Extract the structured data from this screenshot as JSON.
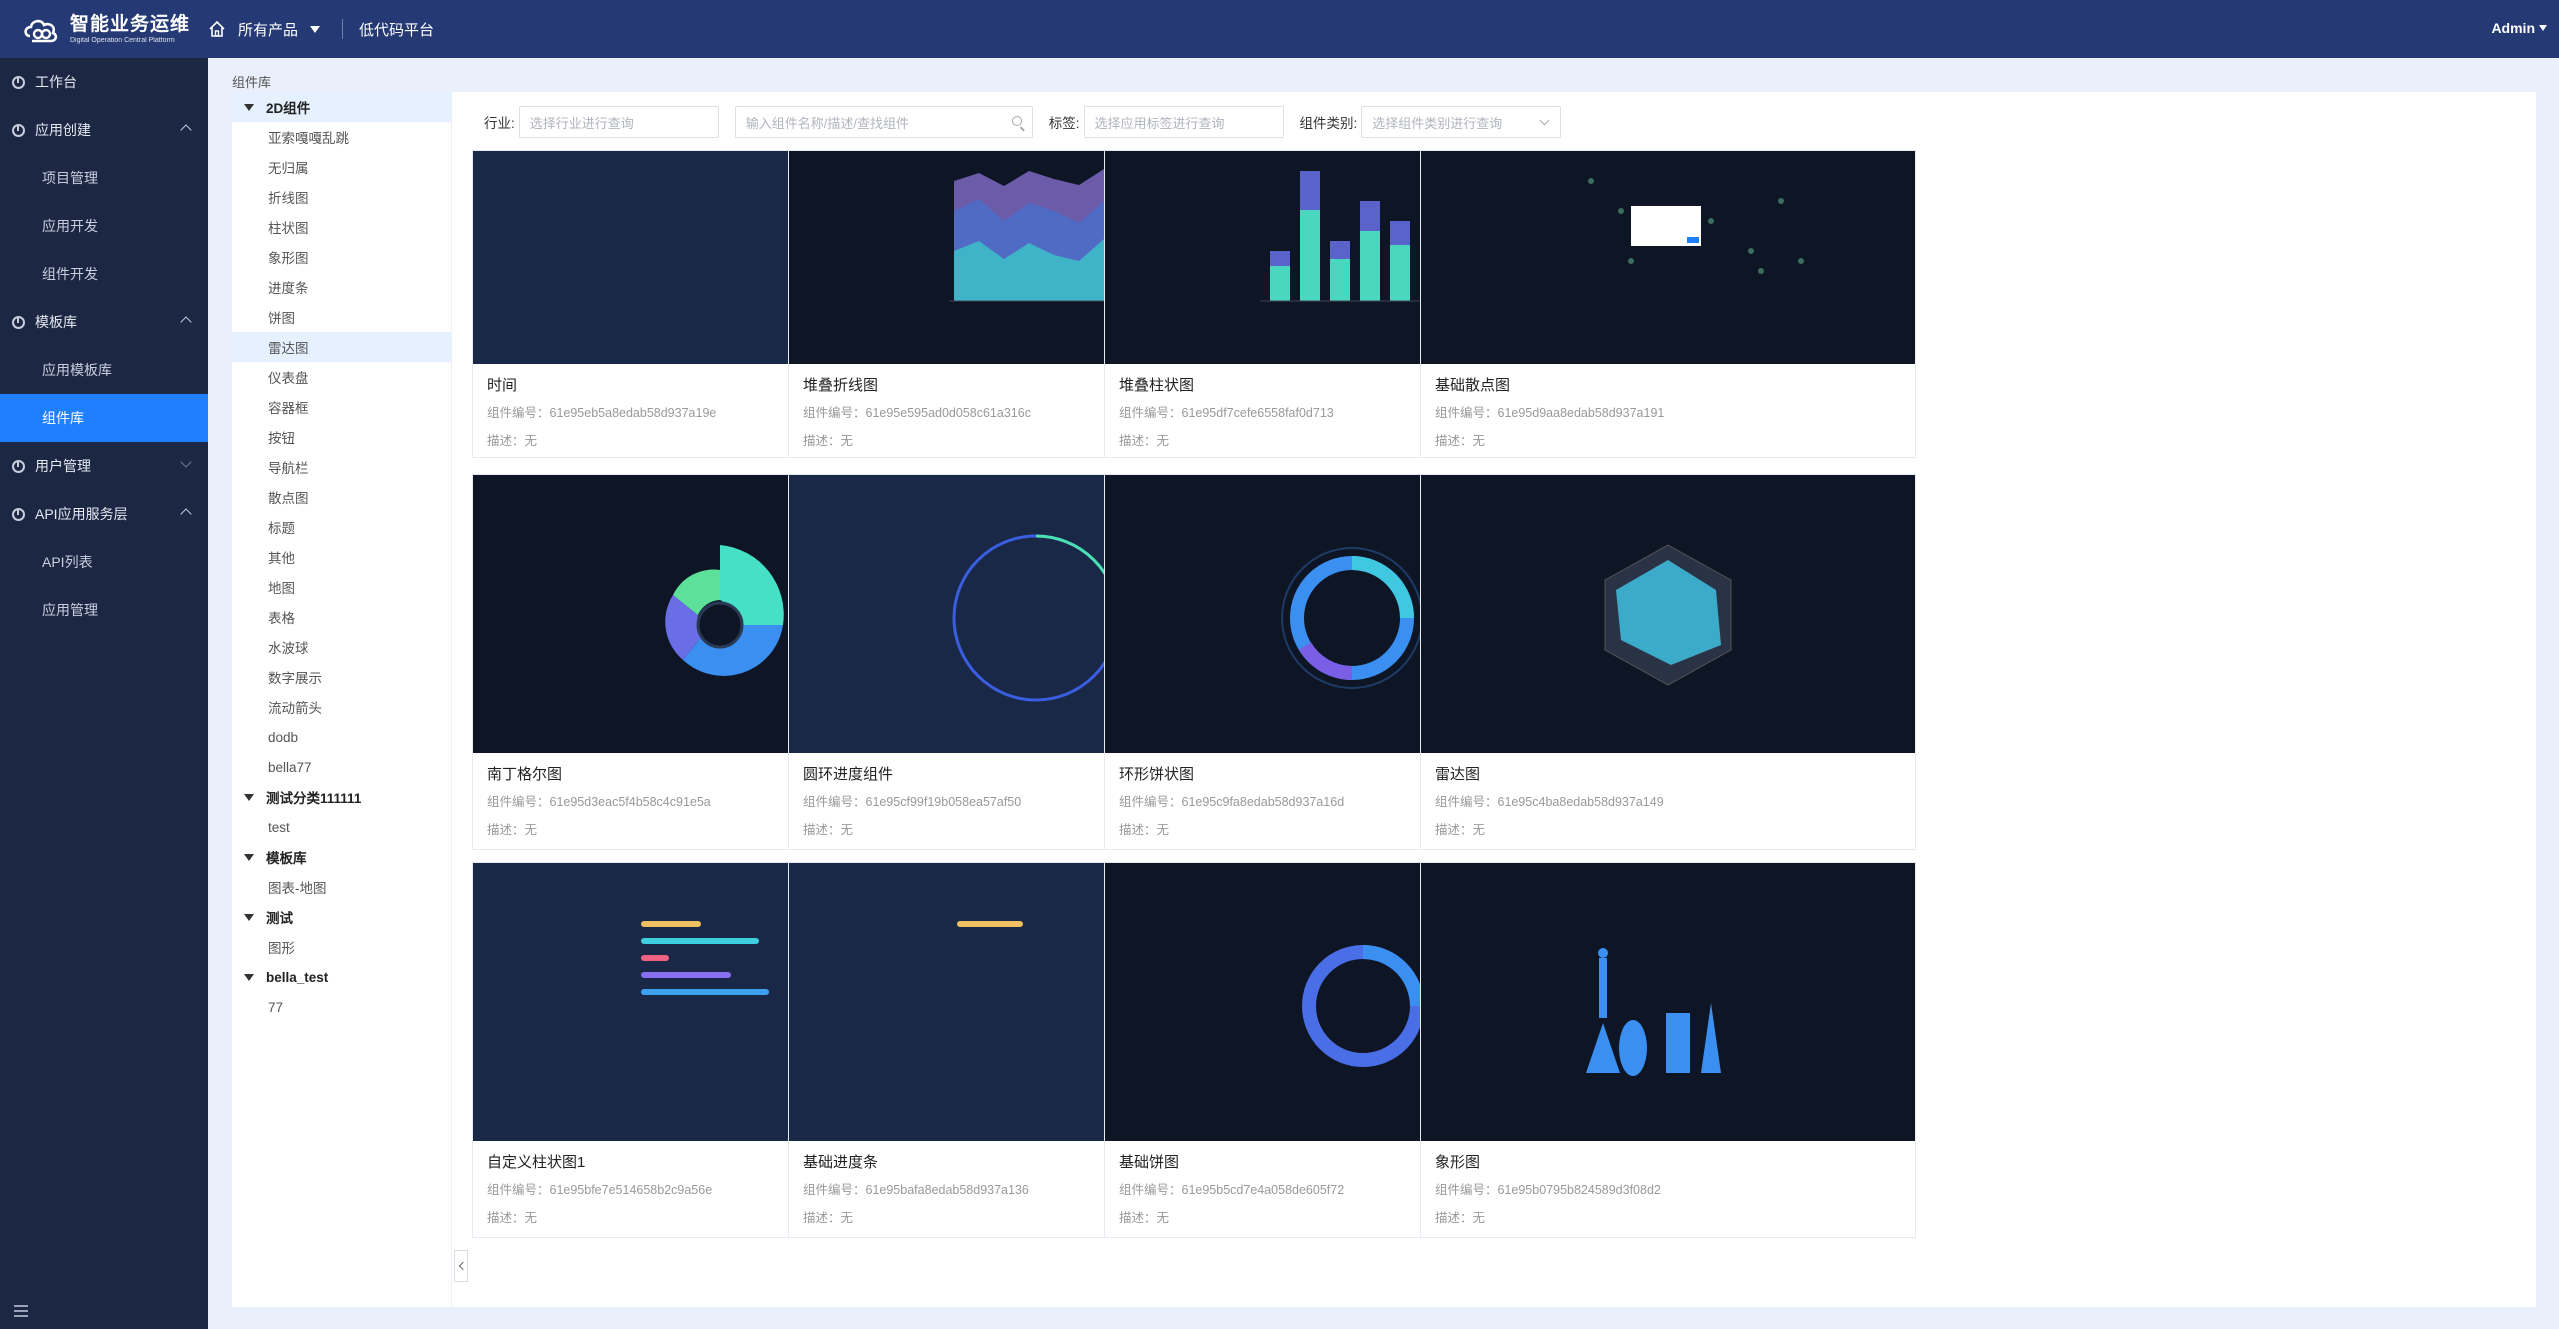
{
  "header": {
    "logo_main": "智能业务运维",
    "logo_sub": "Digital Operation Central Platform",
    "all_products": "所有产品",
    "platform": "低代码平台",
    "user": "Admin"
  },
  "sidebar": {
    "items": [
      {
        "type": "group",
        "label": "工作台"
      },
      {
        "type": "group",
        "label": "应用创建"
      },
      {
        "type": "item",
        "label": "项目管理"
      },
      {
        "type": "item",
        "label": "应用开发"
      },
      {
        "type": "item",
        "label": "组件开发"
      },
      {
        "type": "group",
        "label": "模板库"
      },
      {
        "type": "item",
        "label": "应用模板库"
      },
      {
        "type": "item",
        "label": "组件库",
        "active": true
      },
      {
        "type": "group",
        "label": "用户管理"
      },
      {
        "type": "group",
        "label": "API应用服务层"
      },
      {
        "type": "item",
        "label": "API列表"
      },
      {
        "type": "item",
        "label": "应用管理"
      }
    ]
  },
  "breadcrumb": "组件库",
  "tree": [
    {
      "label": "2D组件",
      "parent": true
    },
    {
      "label": "亚索嘎嘎乱跳"
    },
    {
      "label": "无归属"
    },
    {
      "label": "折线图"
    },
    {
      "label": "柱状图"
    },
    {
      "label": "象形图"
    },
    {
      "label": "进度条"
    },
    {
      "label": "饼图"
    },
    {
      "label": "雷达图",
      "selected": true
    },
    {
      "label": "仪表盘"
    },
    {
      "label": "容器框"
    },
    {
      "label": "按钮"
    },
    {
      "label": "导航栏"
    },
    {
      "label": "散点图"
    },
    {
      "label": "标题"
    },
    {
      "label": "其他"
    },
    {
      "label": "地图"
    },
    {
      "label": "表格"
    },
    {
      "label": "水波球"
    },
    {
      "label": "数字展示"
    },
    {
      "label": "流动箭头"
    },
    {
      "label": "dodb"
    },
    {
      "label": "bella77"
    },
    {
      "label": "测试分类111111",
      "parent": true
    },
    {
      "label": "test"
    },
    {
      "label": "模板库",
      "parent": true
    },
    {
      "label": "图表-地图"
    },
    {
      "label": "测试",
      "parent": true
    },
    {
      "label": "图形"
    },
    {
      "label": "bella_test",
      "parent": true
    },
    {
      "label": "77"
    }
  ],
  "filters": {
    "industry_label": "行业:",
    "industry_placeholder": "选择行业进行查询",
    "search_placeholder": "输入组件名称/描述/查找组件",
    "tag_label": "标签:",
    "tag_placeholder": "选择应用标签进行查询",
    "category_label": "组件类别:",
    "category_placeholder": "选择组件类别进行查询"
  },
  "cards": [
    {
      "title": "时间",
      "id": "组件编号：61e95eb5a8edab58d937a19e",
      "desc": "描述：无"
    },
    {
      "title": "堆叠折线图",
      "id": "组件编号：61e95e595ad0d058c61a316c",
      "desc": "描述：无"
    },
    {
      "title": "堆叠柱状图",
      "id": "组件编号：61e95df7cefe6558faf0d713",
      "desc": "描述：无"
    },
    {
      "title": "基础散点图",
      "id": "组件编号：61e95d9aa8edab58d937a191",
      "desc": "描述：无"
    },
    {
      "title": "南丁格尔图",
      "id": "组件编号：61e95d3eac5f4b58c4c91e5a",
      "desc": "描述：无"
    },
    {
      "title": "圆环进度组件",
      "id": "组件编号：61e95cf99f19b058ea57af50",
      "desc": "描述：无"
    },
    {
      "title": "环形饼状图",
      "id": "组件编号：61e95c9fa8edab58d937a16d",
      "desc": "描述：无"
    },
    {
      "title": "雷达图",
      "id": "组件编号：61e95c4ba8edab58d937a149",
      "desc": "描述：无"
    },
    {
      "title": "自定义柱状图1",
      "id": "组件编号：61e95bfe7e514658b2c9a56e",
      "desc": "描述：无"
    },
    {
      "title": "基础进度条",
      "id": "组件编号：61e95bafa8edab58d937a136",
      "desc": "描述：无"
    },
    {
      "title": "基础饼图",
      "id": "组件编号：61e95b5cd7e4a058de605f72",
      "desc": "描述：无"
    },
    {
      "title": "象形图",
      "id": "组件编号：61e95b0795b824589d3f08d2",
      "desc": "描述：无"
    }
  ]
}
